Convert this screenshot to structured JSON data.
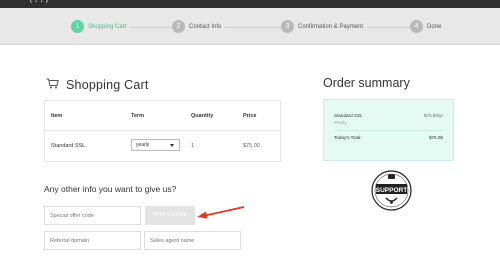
{
  "header": {
    "logo_fragment": "(..)"
  },
  "steps": [
    {
      "num": "1",
      "label": "Shopping Cart"
    },
    {
      "num": "2",
      "label": "Contact Info"
    },
    {
      "num": "3",
      "label": "Confirmation & Payment"
    },
    {
      "num": "4",
      "label": "Done"
    }
  ],
  "cart": {
    "title": "Shopping Cart",
    "columns": [
      "Item",
      "Term",
      "Quantity",
      "Price"
    ],
    "row": {
      "item": "Standard SSL",
      "term": "yearly",
      "quantity": "1",
      "price": "$75.00"
    }
  },
  "other_info": {
    "title": "Any other info you want to give us?",
    "special_offer_placeholder": "Special offer code",
    "apply_label": "APPLY CODE",
    "referral_placeholder": "Referral domain",
    "sales_agent_placeholder": "Sales agent name"
  },
  "order_summary": {
    "title": "Order summary",
    "item": "Standard SSL",
    "item_price": "$75.00/yr",
    "item_term": "Yearly",
    "total_label": "Today's Total:",
    "total": "$75.00"
  },
  "badge": {
    "label": "SUPPORT"
  },
  "colors": {
    "accent": "#5fd5a6",
    "summary_bg": "#e3fbf2",
    "annotation_arrow": "#e2372b"
  }
}
